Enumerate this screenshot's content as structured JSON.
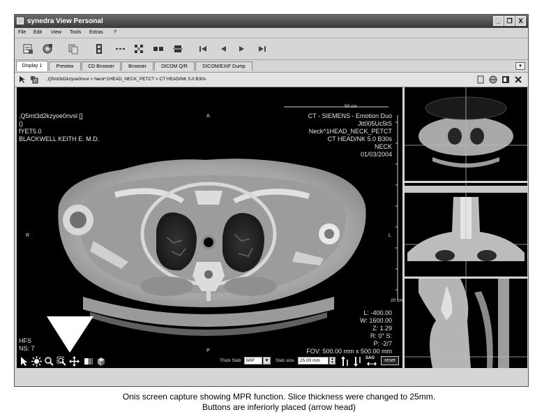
{
  "window": {
    "title": "synedra View Personal",
    "controls": [
      "_",
      "❐",
      "X"
    ]
  },
  "menu": [
    "File",
    "Edit",
    "View",
    "Tools",
    "Extras",
    "?"
  ],
  "tabs": [
    {
      "label": "Display 1",
      "active": true
    },
    {
      "label": "Preview",
      "active": false
    },
    {
      "label": "CD Browser",
      "active": false
    },
    {
      "label": "Browser",
      "active": false
    },
    {
      "label": "DICOM Q/R",
      "active": false
    },
    {
      "label": "DICOM/EXIF Dump",
      "active": false
    }
  ],
  "pathbar": {
    "path": ",Q5mt3d2kzyoe0nvsl > Neck^1HEAD_NECK_PETCT > CT HEAD/NK 5.0 B30s"
  },
  "overlay": {
    "scale": "50 cm",
    "top_left": [
      ",Q5mt3d2kzyoe0nvsl  []",
      " ()",
      "fYET5.0",
      "BLACKWELL KEITH E. M.D."
    ],
    "top_right": [
      "CT - SIEMENS - Emotion Duo",
      "Jtt005Uc5tS",
      "Neck^1HEAD_NECK_PETCT",
      "CT HEAD/NK 5.0 B30s",
      "NECK",
      "01/03/2004"
    ],
    "orientation": {
      "top": "A",
      "left": "R",
      "right": "L",
      "bottom": "P"
    },
    "bottom_left": [
      "HFS",
      "NS: 7"
    ],
    "bottom_right": [
      "L: -400.00",
      "W: 1600.00",
      "Z: 1.29",
      "R: 0° S:",
      "P: -2/7",
      "FOV: 500.00 mm x 500.00 mm"
    ],
    "ruler": "20 cm"
  },
  "bottom_toolbar": {
    "thick_slab_label": "Thick Slab",
    "thick_slab_value": "MIP",
    "slab_size_label": "Slab size",
    "slab_size_value": "25,00 mm",
    "sag_label": "SAG",
    "reset_label": "reset"
  },
  "caption": {
    "line1": "Onis screen capture showing MPR function. Slice thickness were changed to 25mm.",
    "line2": "Buttons are inferiorly placed (arrow head)"
  }
}
